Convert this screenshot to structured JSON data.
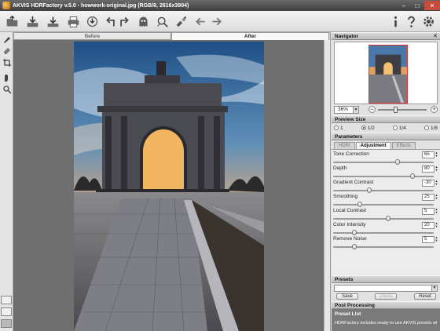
{
  "window": {
    "title": "AKVIS HDRFactory v.5.0 - howwork-original.jpg (RGB/8, 2616x3904)",
    "minimize": "–",
    "maximize": "□",
    "close": "✕"
  },
  "toolbar": {
    "buttons": [
      "open-icon",
      "save-icon",
      "print-icon",
      "share-icon",
      "undo-icon",
      "redo-icon",
      "reset-ghost-icon",
      "batch-icon",
      "plugin-icon",
      "back-arrow-icon",
      "forward-arrow-icon",
      "info-icon",
      "help-icon",
      "settings-icon"
    ]
  },
  "view_tabs": {
    "before": "Before",
    "after": "After",
    "active": "After"
  },
  "navigator": {
    "title": "Navigator",
    "zoom": "36%",
    "zoom_percent": 36,
    "minus": "–",
    "plus": "+"
  },
  "preview_size": {
    "title": "Preview Size",
    "options": [
      "1",
      "1/2",
      "1/4",
      "1/8"
    ],
    "selected": "1/2"
  },
  "parameters": {
    "title": "Parameters",
    "tabs": [
      "HDRI",
      "Adjustment",
      "Effects"
    ],
    "active_tab": "Adjustment",
    "sliders": [
      {
        "label": "Tone Correction",
        "value": "65",
        "level": 0.65
      },
      {
        "label": "Depth",
        "value": "80",
        "level": 0.8
      },
      {
        "label": "Gradient Contrast",
        "value": "-30",
        "level": 0.35
      },
      {
        "label": "Smoothing",
        "value": "25",
        "level": 0.25
      },
      {
        "label": "Local Contrast",
        "value": "5",
        "level": 0.55
      },
      {
        "label": "Color Intensity",
        "value": "20",
        "level": 0.2
      },
      {
        "label": "Remove Noise",
        "value": "5",
        "level": 0.2
      }
    ]
  },
  "presets": {
    "title": "Presets",
    "save": "Save",
    "delete": "Delete",
    "reset": "Reset"
  },
  "post_processing": {
    "title": "Post Processing"
  },
  "preset_list": {
    "title": "Preset List",
    "description": "HDRFactory includes ready-to-use AKVIS presets which help you start working and save your time."
  }
}
